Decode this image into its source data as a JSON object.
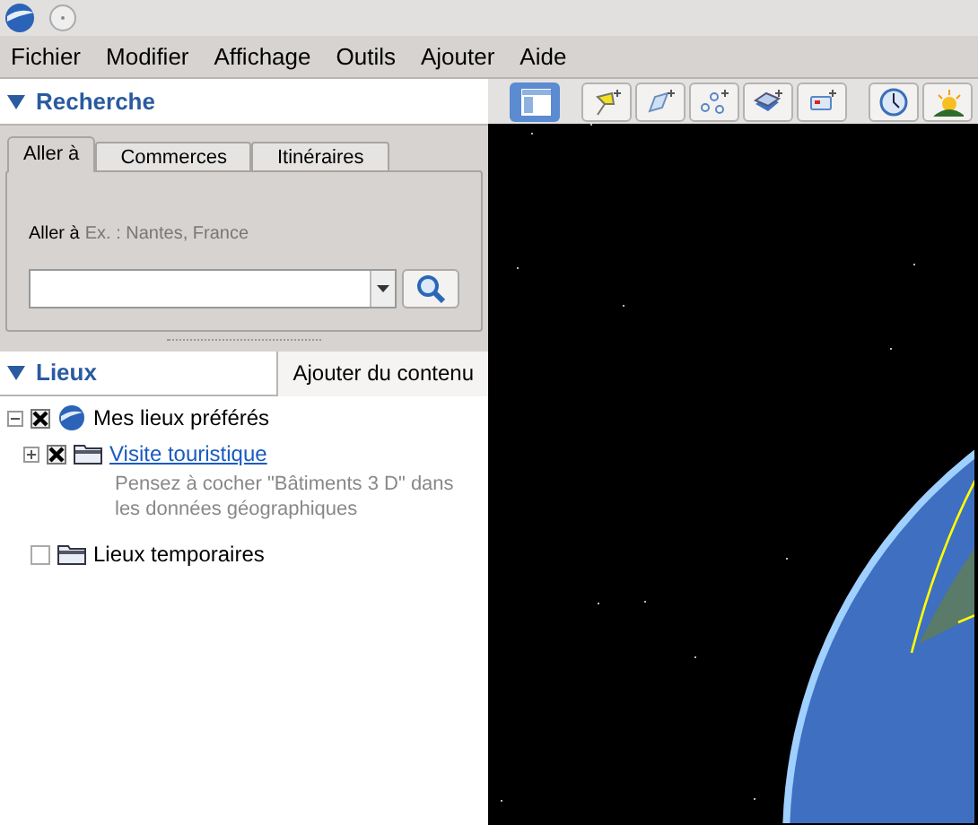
{
  "menu": [
    "Fichier",
    "Modifier",
    "Affichage",
    "Outils",
    "Ajouter",
    "Aide"
  ],
  "search": {
    "title": "Recherche",
    "expanded": true,
    "tabs": [
      {
        "label": "Aller à",
        "selected": true
      },
      {
        "label": "Commerces",
        "selected": false
      },
      {
        "label": "Itinéraires",
        "selected": false
      }
    ],
    "field_label": "Aller à",
    "hint": "Ex. : Nantes, France"
  },
  "places": {
    "title": "Lieux",
    "expanded": true,
    "add_button": "Ajouter du contenu",
    "tree": [
      {
        "label": "Mes lieux préférés",
        "kind": "earth",
        "checked": true,
        "expanded": true,
        "children": [
          {
            "label": "Visite touristique",
            "kind": "folder",
            "link": true,
            "checked": true,
            "expanded": false,
            "description": "Pensez à cocher \"Bâtiments 3 D\" dans les données géographiques"
          }
        ]
      },
      {
        "label": "Lieux temporaires",
        "kind": "folder",
        "checked": false
      }
    ]
  },
  "toolbar": [
    {
      "kind": "sidebar",
      "selected": true
    },
    {
      "kind": "placemark",
      "selected": false
    },
    {
      "kind": "polygon",
      "selected": false
    },
    {
      "kind": "path",
      "selected": false
    },
    {
      "kind": "overlay",
      "selected": false
    },
    {
      "kind": "tour",
      "selected": false
    },
    {
      "kind": "history",
      "selected": false
    },
    {
      "kind": "sun",
      "selected": false
    }
  ]
}
